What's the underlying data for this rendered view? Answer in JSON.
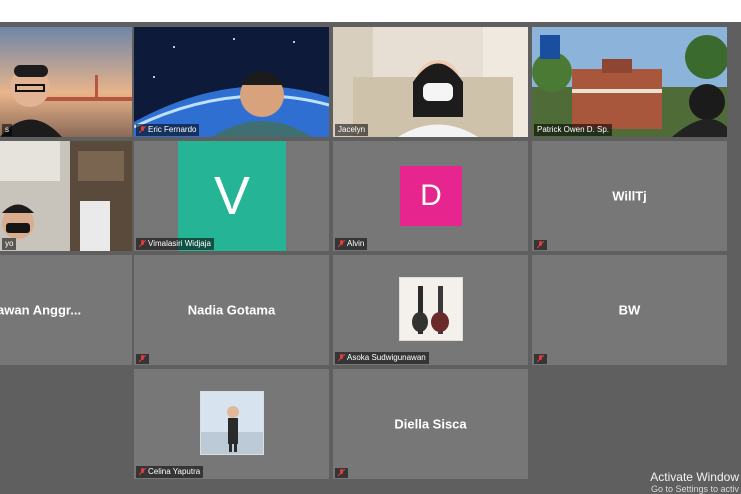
{
  "participants": [
    {
      "name": "Eric Fernardo",
      "caption": "Eric Fernardo"
    },
    {
      "name": "Jacelyn",
      "caption": "Jacelyn"
    },
    {
      "name": "Patrick Owen D. Sp.",
      "caption": "Patrick Owen D. Sp."
    },
    {
      "name": "Vimalasiri Widjaja",
      "caption": "Vimalasiri Widjaja",
      "initial": "V",
      "color": "#26b496"
    },
    {
      "name": "Alvin",
      "caption": "Alvin",
      "initial": "D",
      "color": "#e6258f"
    },
    {
      "name": "WillTj"
    },
    {
      "name": "Nadia Gotama"
    },
    {
      "name": "Asoka Sudwigunawan",
      "caption": "Asoka Sudwigunawan"
    },
    {
      "name": "BW"
    },
    {
      "name": "Celina Yaputra",
      "caption": "Celina Yaputra"
    },
    {
      "name": "Diella Sisca"
    },
    {
      "name": "...awan Anggr...",
      "display": "rawan  Anggr..."
    },
    {
      "name": "...yo",
      "caption": "yo"
    },
    {
      "name": "s",
      "caption": "s"
    }
  ],
  "watermark": {
    "line1": "Activate Window",
    "line2": "Go to Settings to activ"
  },
  "colors": {
    "background": "#5f5f5f",
    "tile": "#777777"
  }
}
